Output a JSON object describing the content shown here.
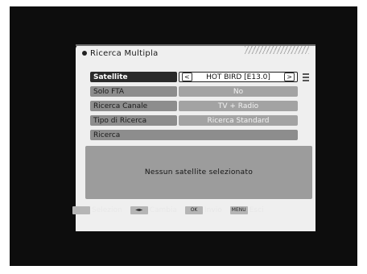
{
  "title": "Ricerca Multipla",
  "rows": [
    {
      "label": "Satellite",
      "value": "HOT BIRD [E13.0]"
    },
    {
      "label": "Solo FTA",
      "value": "No"
    },
    {
      "label": "Ricerca Canale",
      "value": "TV + Radio"
    },
    {
      "label": "Tipo di Ricerca",
      "value": "Ricerca Standard"
    },
    {
      "label": "Ricerca",
      "value": ""
    }
  ],
  "arrow_left": "<",
  "arrow_right": ">",
  "message": "Nessun satellite selezionato",
  "footer": [
    {
      "key": "",
      "label": "Selezion"
    },
    {
      "key": "◄►",
      "label": "Cambia"
    },
    {
      "key": "OK",
      "label": "Invio"
    },
    {
      "key": "MENU",
      "label": "Esci"
    }
  ]
}
